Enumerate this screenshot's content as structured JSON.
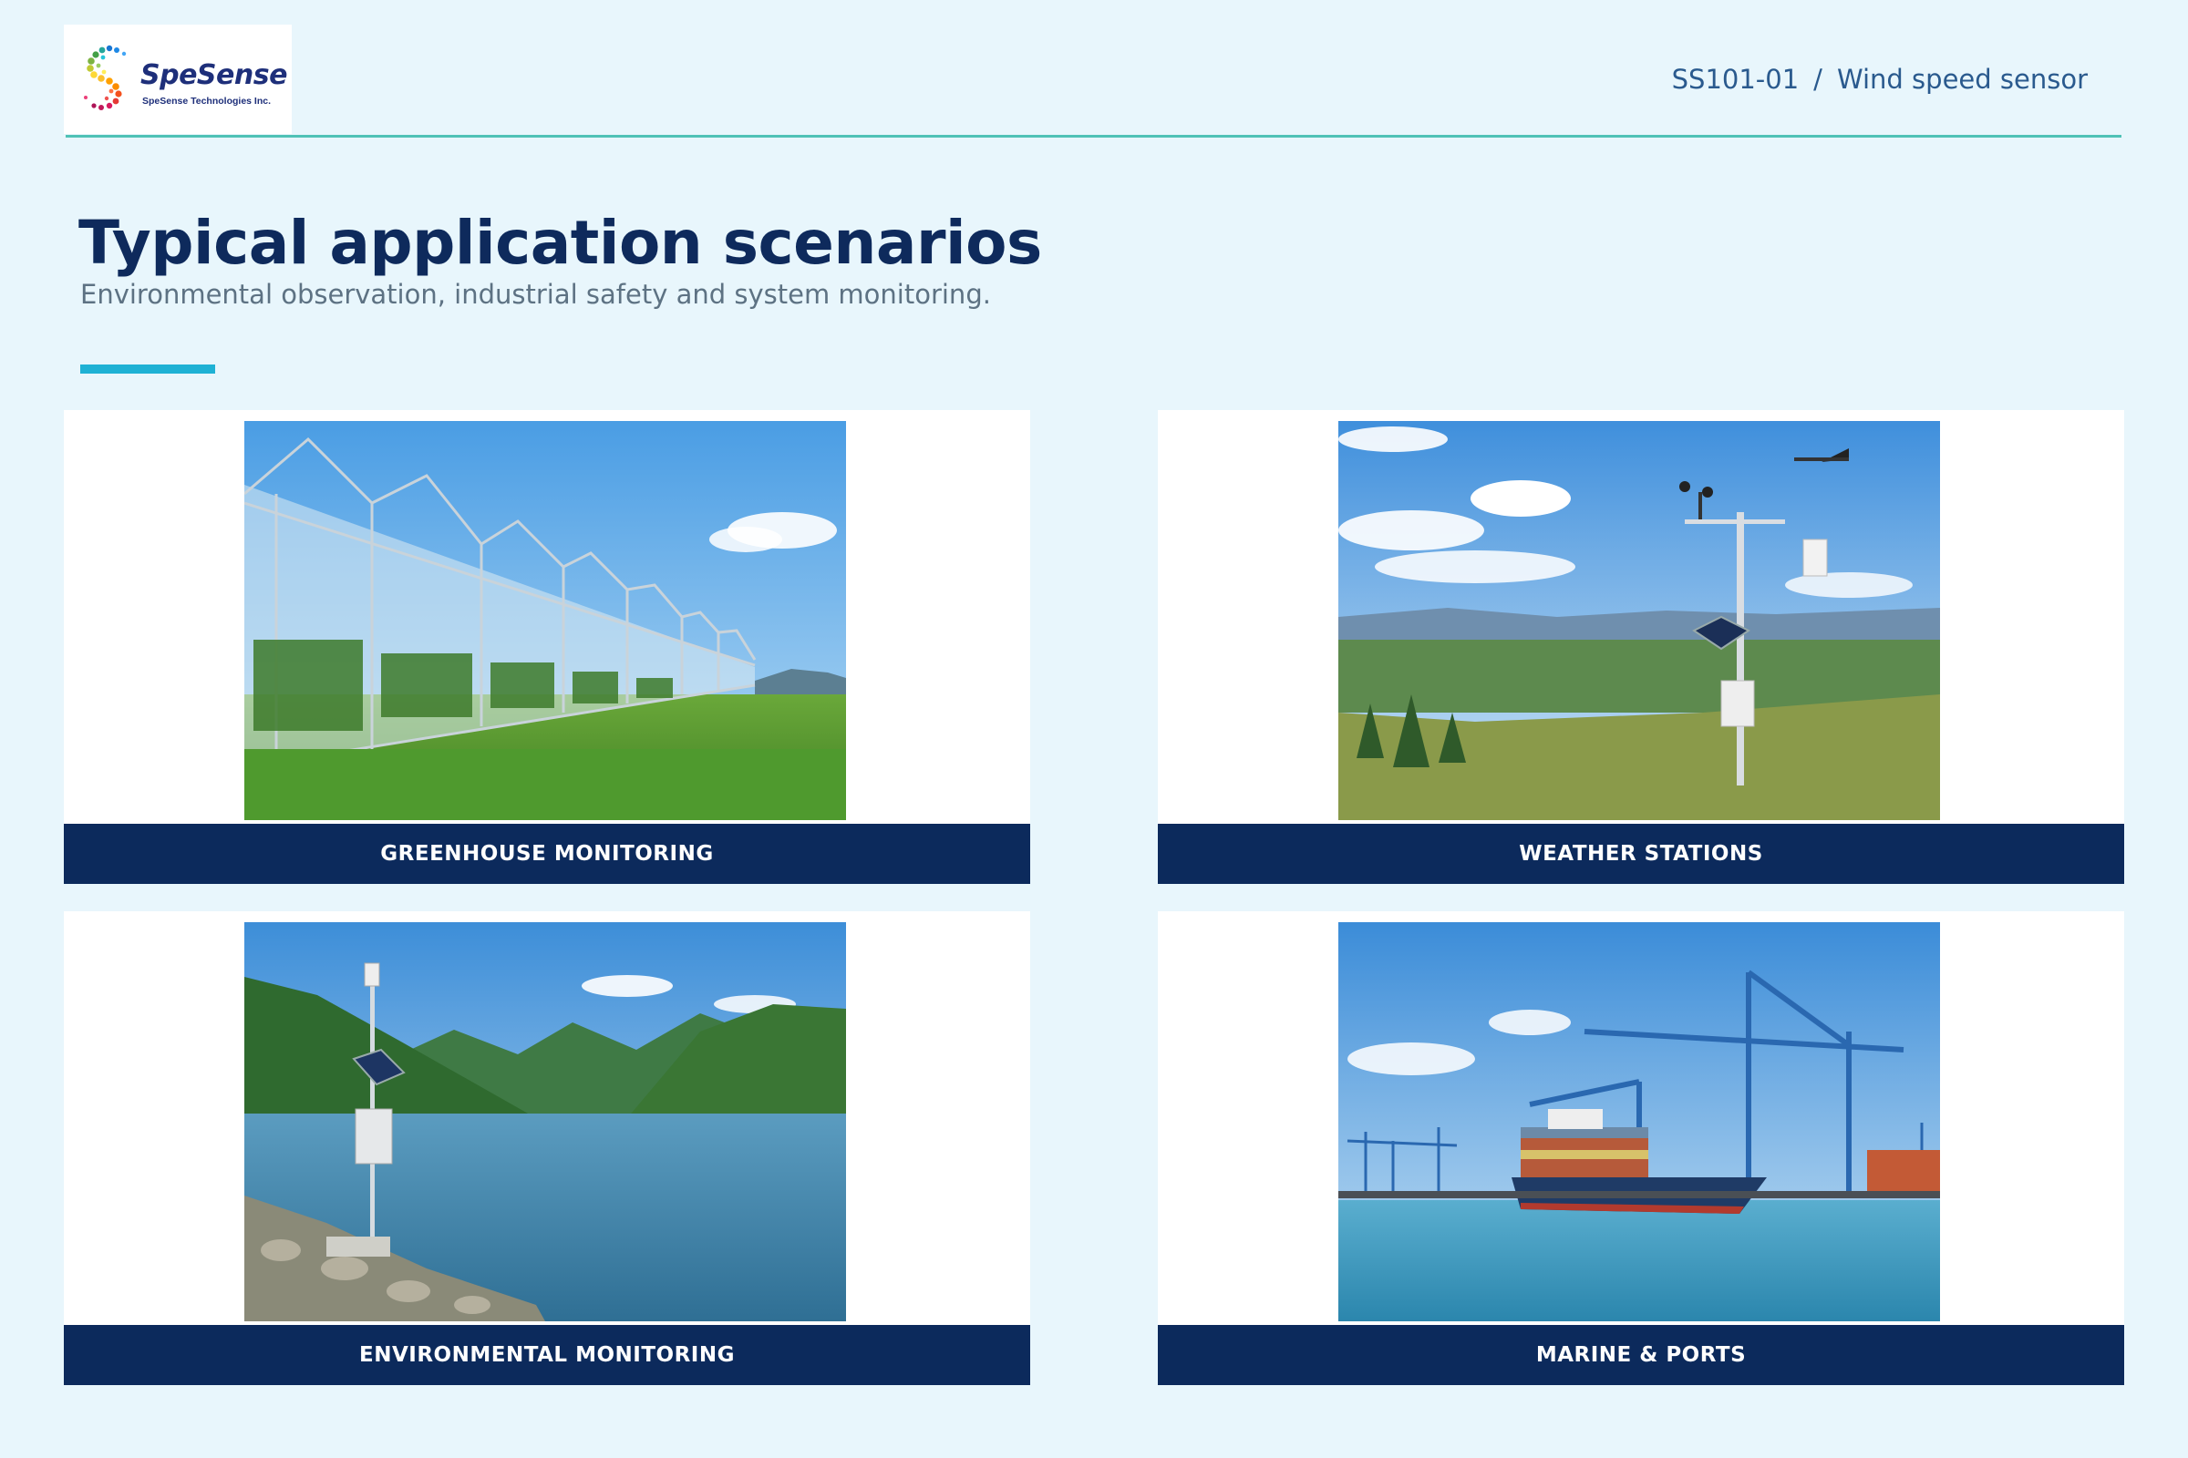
{
  "brand": {
    "name": "SpeSense",
    "company": "SpeSense Technologies Inc.",
    "logo_icon": "spiral-dots-logo"
  },
  "header": {
    "product_code": "SS101-01",
    "separator": "/",
    "product_name": "Wind speed sensor"
  },
  "page": {
    "title": "Typical application scenarios",
    "subtitle": "Environmental observation, industrial safety and system monitoring."
  },
  "scenarios": [
    {
      "label": "GREENHOUSE MONITORING",
      "image": "greenhouse-photo"
    },
    {
      "label": "WEATHER STATIONS",
      "image": "weather-station-photo"
    },
    {
      "label": "ENVIRONMENTAL MONITORING",
      "image": "lake-monitoring-photo"
    },
    {
      "label": "MARINE & PORTS",
      "image": "container-port-photo"
    }
  ],
  "colors": {
    "background": "#e8f6fc",
    "navy": "#0c2a5c",
    "accent": "#1eb1d4",
    "rule": "#4fc2b6"
  }
}
